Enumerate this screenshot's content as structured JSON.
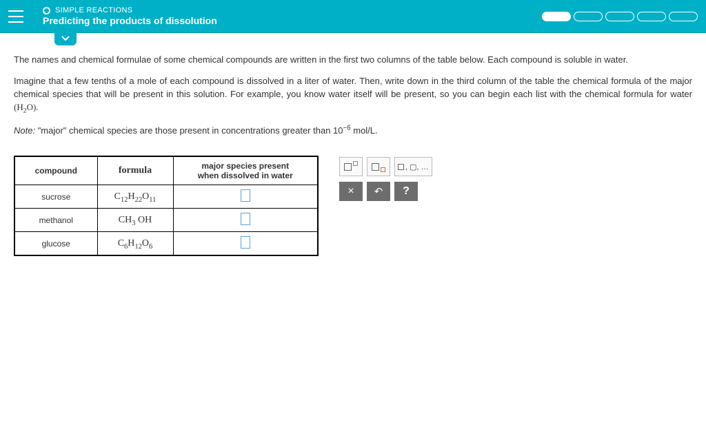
{
  "header": {
    "category": "SIMPLE REACTIONS",
    "title": "Predicting the products of dissolution"
  },
  "instructions": {
    "p1": "The names and chemical formulae of some chemical compounds are written in the first two columns of the table below. Each compound is soluble in water.",
    "p2_a": "Imagine that a few tenths of a mole of each compound is dissolved in a liter of water. Then, write down in the third column of the table the chemical formula of the major chemical species that will be present in this solution. For example, you know water itself will be present, so you can begin each list with the chemical formula for water ",
    "water_formula_prefix": "(H",
    "water_formula_sub": "2",
    "water_formula_suffix": "O).",
    "note_label": "Note:",
    "note_body_a": " \"major\" chemical species are those present in concentrations greater than 10",
    "note_exp": "−6",
    "note_body_b": " mol/L."
  },
  "table": {
    "headers": {
      "c1": "compound",
      "c2": "formula",
      "c3": "major species present\nwhen dissolved in water"
    },
    "rows": [
      {
        "name": "sucrose",
        "formula_parts": [
          "C",
          "12",
          "H",
          "22",
          "O",
          "11"
        ]
      },
      {
        "name": "methanol",
        "formula_plain": "CH",
        "formula_sub": "3",
        "formula_tail": " OH"
      },
      {
        "name": "glucose",
        "formula_parts": [
          "C",
          "6",
          "H",
          "12",
          "O",
          "6"
        ]
      }
    ]
  },
  "tools": {
    "comma_hint": ", ▢, …",
    "close": "×",
    "undo": "↶",
    "help": "?"
  }
}
